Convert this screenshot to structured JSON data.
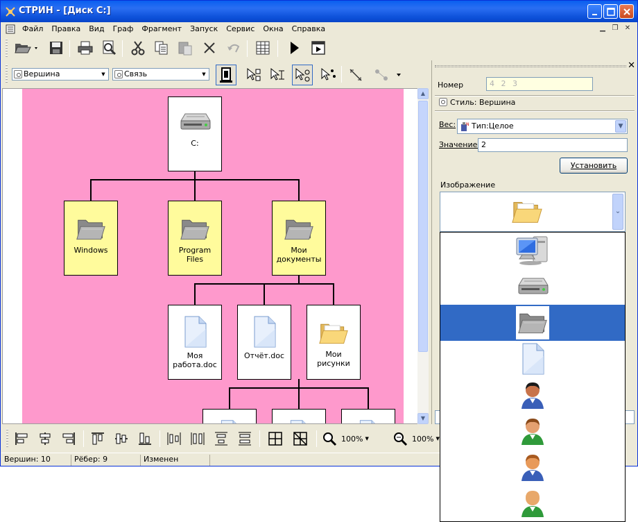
{
  "window": {
    "title": "СТРИН - [Диск C:]"
  },
  "menu": [
    "Файл",
    "Правка",
    "Вид",
    "Граф",
    "Фрагмент",
    "Запуск",
    "Сервис",
    "Окна",
    "Справка"
  ],
  "style_toolbar": {
    "node_style": "Вершина",
    "edge_style": "Связь"
  },
  "graph": {
    "nodes": [
      {
        "id": "disk-c",
        "label": "C:",
        "icon": "hard-drive-icon"
      },
      {
        "id": "windows",
        "label": "Windows",
        "icon": "folder-icon"
      },
      {
        "id": "program-files",
        "label": "Program Files",
        "icon": "folder-icon"
      },
      {
        "id": "my-documents",
        "label": "Мои документы",
        "icon": "folder-icon"
      },
      {
        "id": "my-work",
        "label": "Моя работа.doc",
        "icon": "document-icon"
      },
      {
        "id": "report",
        "label": "Отчёт.doc",
        "icon": "document-icon"
      },
      {
        "id": "my-pictures",
        "label": "Мои рисунки",
        "icon": "open-folder-icon"
      }
    ]
  },
  "panel": {
    "number_label": "Номер",
    "number_value": "4 2 3",
    "style_label": "Стиль: Вершина",
    "weight_label": "Вес:",
    "weight_type": "Тип:Целое",
    "value_label": "Значение:",
    "value": "2",
    "set_button": "Установить",
    "image_label": "Изображение",
    "image_selected": "open-folder-icon",
    "image_options": [
      "computer-icon",
      "hard-drive-icon",
      "folder-icon",
      "document-icon",
      "user-dark-icon",
      "user-woman-icon",
      "user-orange-icon",
      "user-bald-icon"
    ],
    "image_selected_index": 2
  },
  "bottom_toolbar": {
    "zoom1": "100%",
    "zoom2": "100%"
  },
  "status": {
    "vertices": "Вершин: 10",
    "edges": "Рёбер: 9",
    "state": "Изменен"
  },
  "colors": {
    "canvas_bg": "#fe99cc",
    "folder_node_bg": "#fffb9c",
    "selection": "#316ac5",
    "titlebar": "#0a5ff0"
  }
}
